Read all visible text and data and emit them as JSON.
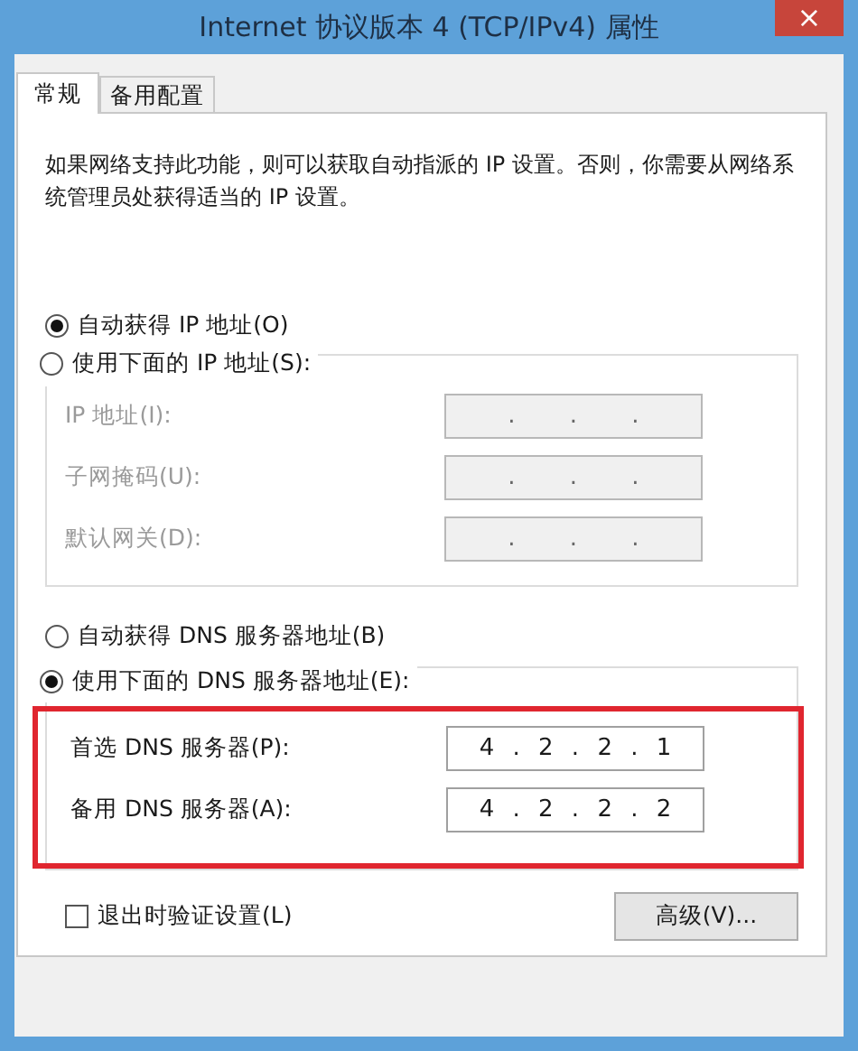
{
  "window": {
    "title": "Internet 协议版本 4 (TCP/IPv4) 属性",
    "close": "×"
  },
  "tabs": [
    {
      "label": "常规",
      "selected": true
    },
    {
      "label": "备用配置",
      "selected": false
    }
  ],
  "description": "如果网络支持此功能，则可以获取自动指派的 IP 设置。否则，你需要从网络系统管理员处获得适当的 IP 设置。",
  "ip_options": [
    {
      "label": "自动获得 IP 地址(O)",
      "selected": true
    },
    {
      "label": "使用下面的 IP 地址(S):",
      "selected": false
    }
  ],
  "ip_fields": [
    {
      "label": "IP 地址(I):",
      "value": ". . .",
      "disabled": true
    },
    {
      "label": "子网掩码(U):",
      "value": ". . .",
      "disabled": true
    },
    {
      "label": "默认网关(D):",
      "value": ". . .",
      "disabled": true
    }
  ],
  "dns_options": [
    {
      "label": "自动获得 DNS 服务器地址(B)",
      "selected": false
    },
    {
      "label": "使用下面的 DNS 服务器地址(E):",
      "selected": true
    }
  ],
  "dns_fields": [
    {
      "label": "首选 DNS 服务器(P):",
      "value": "4 . 2 . 2 . 1",
      "disabled": false
    },
    {
      "label": "备用 DNS 服务器(A):",
      "value": "4 . 2 . 2 . 2",
      "disabled": false
    }
  ],
  "highlight": {
    "color": "#e0262f"
  },
  "validate_on_exit": {
    "label": "退出时验证设置(L)",
    "checked": false
  },
  "advanced_button": "高级(V)..."
}
